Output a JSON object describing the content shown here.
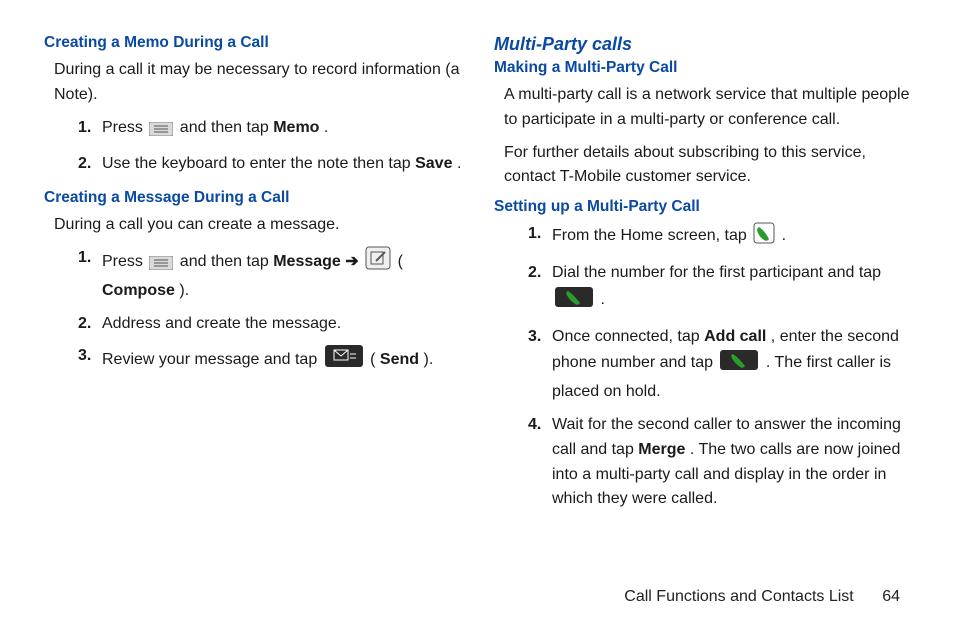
{
  "left": {
    "h1": "Creating a Memo During a Call",
    "p1": "During a call it may be necessary to record information (a Note).",
    "s1_a": "Press ",
    "s1_b": " and then tap ",
    "s1_c": "Memo",
    "s1_d": ".",
    "s2_a": "Use the keyboard to enter the note then tap ",
    "s2_b": "Save",
    "s2_c": ".",
    "h2": "Creating a Message During a Call",
    "p2": "During a call you can create a message.",
    "m1_a": "Press ",
    "m1_b": " and then tap ",
    "m1_c": "Message",
    "m1_d": " ➔ ",
    "m1_e": " (",
    "m1_f": "Compose",
    "m1_g": ").",
    "m2": "Address and create the message.",
    "m3_a": "Review your message and tap ",
    "m3_b": " (",
    "m3_c": "Send",
    "m3_d": ")."
  },
  "right": {
    "h0": "Multi-Party calls",
    "h1": "Making a Multi-Party Call",
    "p1": "A multi-party call is a network service that multiple people to participate in a multi-party or conference call.",
    "p2": "For further details about subscribing to this service, contact T-Mobile customer service.",
    "h2": "Setting up a Multi-Party Call",
    "s1_a": "From the Home screen, tap ",
    "s1_b": " .",
    "s2_a": "Dial the number for the first participant and tap ",
    "s2_b": ".",
    "s3_a": "Once connected, tap ",
    "s3_b": "Add call",
    "s3_c": ", enter the second phone number and tap ",
    "s3_d": ". The first caller is placed on hold.",
    "s4_a": "Wait for the second caller to answer the incoming call and tap ",
    "s4_b": "Merge",
    "s4_c": ". The two calls are now joined into a multi-party call and display in the order in which they were called."
  },
  "footer": {
    "section": "Call Functions and Contacts List",
    "page": "64"
  }
}
